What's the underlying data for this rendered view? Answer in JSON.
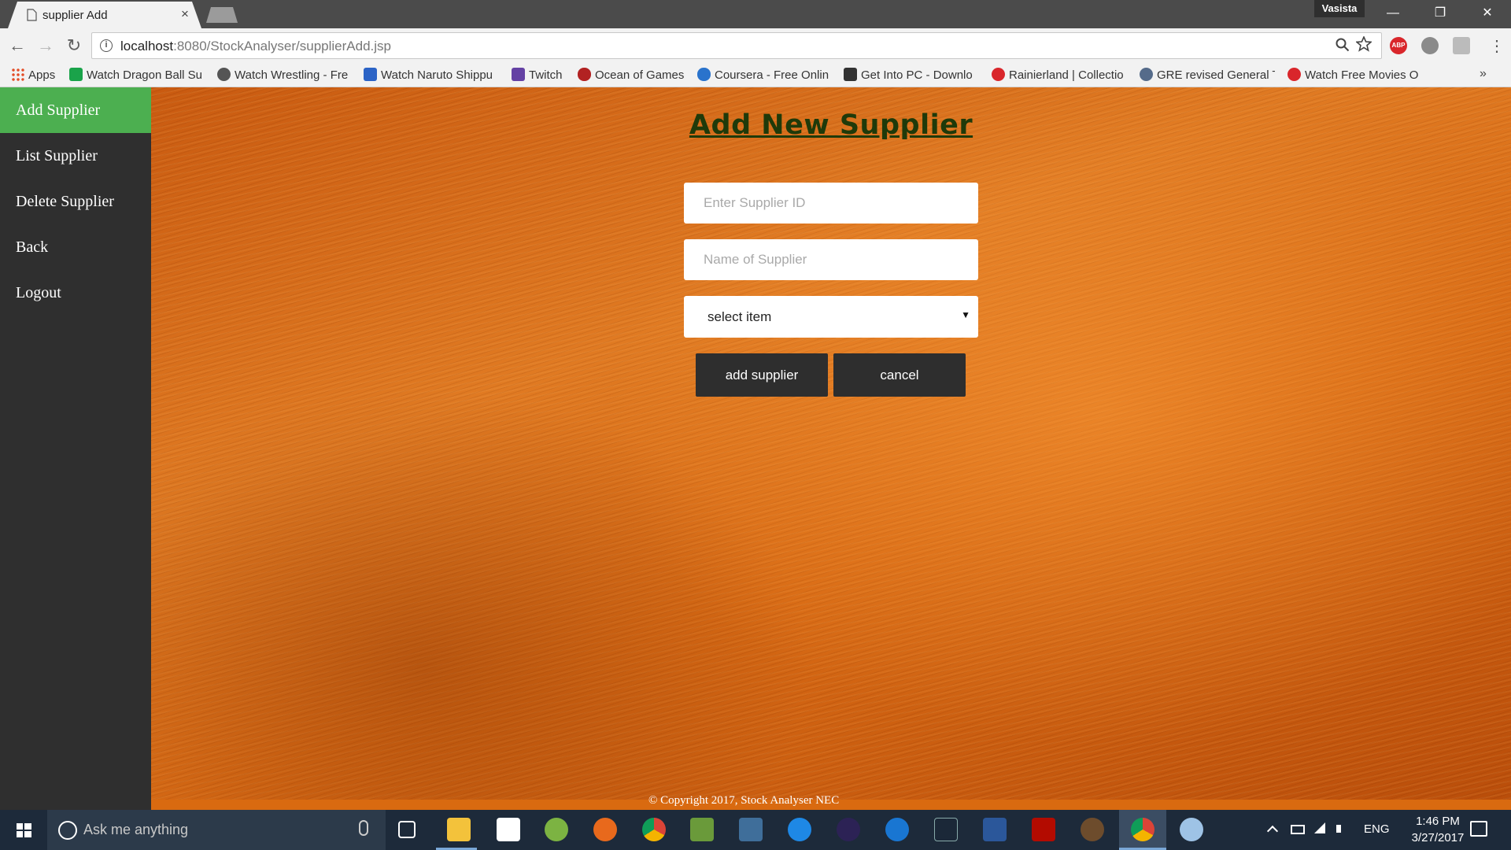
{
  "browser": {
    "tab_title": "supplier Add",
    "tab_close": "×",
    "profile_name": "Vasista",
    "window_controls": {
      "minimize": "—",
      "restore": "❐",
      "close": "✕"
    },
    "url_host": "localhost",
    "url_rest": ":8080/StockAnalyser/supplierAdd.jsp",
    "nav": {
      "back": "←",
      "forward": "→",
      "reload": "↻"
    },
    "menu": "⋮",
    "bookmarks_more": "»"
  },
  "bookmarks": [
    {
      "label": "Apps",
      "icon": "apps-grid-icon",
      "color": "#e34c26"
    },
    {
      "label": "Watch Dragon Ball Su",
      "icon": "tv-icon",
      "color": "#1aa34a"
    },
    {
      "label": "Watch Wrestling - Fre",
      "icon": "wordpress-icon",
      "color": "#555555"
    },
    {
      "label": "Watch Naruto Shippu",
      "icon": "user-icon",
      "color": "#2b63c6"
    },
    {
      "label": "Twitch",
      "icon": "twitch-icon",
      "color": "#6441a4"
    },
    {
      "label": "Ocean of Games",
      "icon": "gamepad-icon",
      "color": "#b22222"
    },
    {
      "label": "Coursera - Free Onlin",
      "icon": "coursera-icon",
      "color": "#2a73cc"
    },
    {
      "label": "Get Into PC - Downlo",
      "icon": "getintopc-icon",
      "color": "#333333"
    },
    {
      "label": "Rainierland | Collectio",
      "icon": "play-icon",
      "color": "#d9262b"
    },
    {
      "label": "GRE revised General T",
      "icon": "ets-icon",
      "color": "#556b8a"
    },
    {
      "label": "Watch Free Movies O",
      "icon": "movie-icon",
      "color": "#d9262b"
    }
  ],
  "sidebar": {
    "items": [
      {
        "label": "Add Supplier",
        "active": true
      },
      {
        "label": "List Supplier",
        "active": false
      },
      {
        "label": "Delete Supplier",
        "active": false
      },
      {
        "label": "Back",
        "active": false
      },
      {
        "label": "Logout",
        "active": false
      }
    ],
    "active_color": "#4caf50"
  },
  "form": {
    "title": "Add New Supplier",
    "supplier_id_placeholder": "Enter Supplier ID",
    "supplier_name_placeholder": "Name of Supplier",
    "select_value": "select item",
    "select_arrow": "▼",
    "add_button": "add supplier",
    "cancel_button": "cancel"
  },
  "footer": {
    "copyright": "© Copyright 2017, Stock Analyser NEC"
  },
  "taskbar": {
    "search_placeholder": "Ask me anything",
    "language": "ENG",
    "time": "1:46 PM",
    "date": "3/27/2017",
    "apps": [
      "task-view-icon",
      "file-explorer-icon",
      "store-icon",
      "android-studio-icon",
      "firefox-icon",
      "chrome-icon",
      "minecraft-icon",
      "mysql-icon",
      "ie-icon",
      "eclipse-icon",
      "edge-icon",
      "steam-icon",
      "word-icon",
      "acrobat-icon",
      "settings-gear-icon",
      "chrome-active-icon",
      "paint-icon"
    ]
  },
  "colors": {
    "title_color": "#1f3a0a",
    "button_bg": "#2e2e2e",
    "background_orange": "#d86a14"
  }
}
